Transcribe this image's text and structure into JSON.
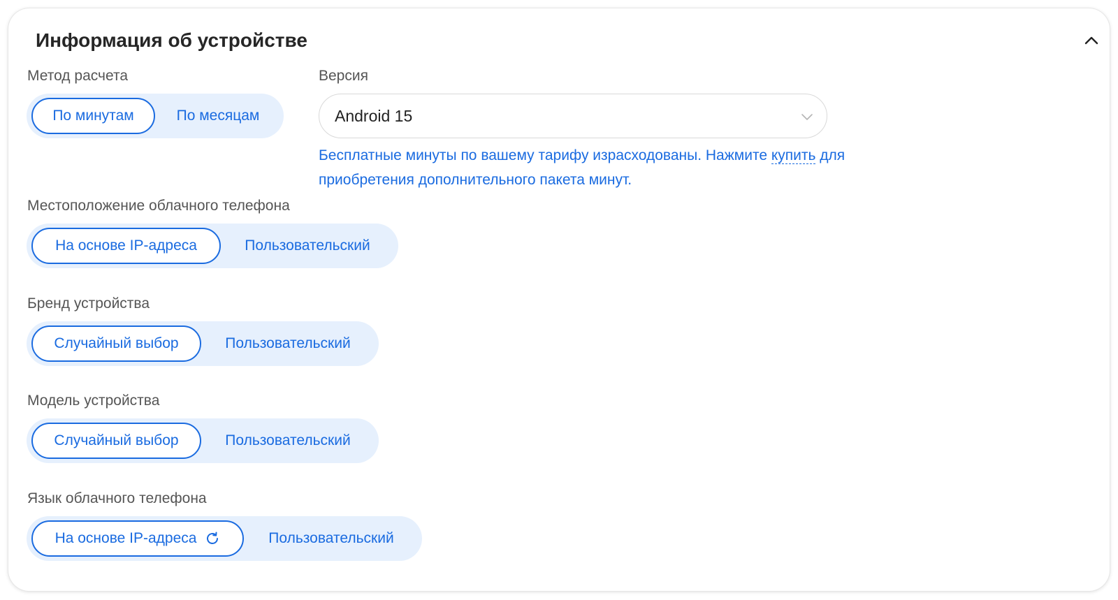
{
  "panel": {
    "title": "Информация об устройстве",
    "collapse_icon": "chevron-up-icon"
  },
  "billing": {
    "label": "Метод расчета",
    "options": [
      "По минутам",
      "По месяцам"
    ],
    "selected": "По минутам"
  },
  "version": {
    "label": "Версия",
    "value": "Android 15",
    "arrow_icon": "chevron-down-icon"
  },
  "notice": {
    "text_before": "Бесплатные минуты по вашему тарифу израсходованы. Нажмите ",
    "link": "купить",
    "text_after": " для приобретения дополнительного пакета минут."
  },
  "location": {
    "label": "Местоположение облачного телефона",
    "options": [
      "На основе IP-адреса",
      "Пользовательский"
    ],
    "selected": "На основе IP-адреса"
  },
  "brand": {
    "label": "Бренд устройства",
    "options": [
      "Случайный выбор",
      "Пользовательский"
    ],
    "selected": "Случайный выбор"
  },
  "model": {
    "label": "Модель устройства",
    "options": [
      "Случайный выбор",
      "Пользовательский"
    ],
    "selected": "Случайный выбор"
  },
  "language": {
    "label": "Язык облачного телефона",
    "options": [
      "На основе IP-адреса",
      "Пользовательский"
    ],
    "selected": "На основе IP-адреса",
    "refresh_icon": "refresh-icon"
  },
  "colors": {
    "accent": "#1a6be0",
    "segment_bg": "#e6f0fd",
    "label": "#555555",
    "title": "#262626"
  }
}
